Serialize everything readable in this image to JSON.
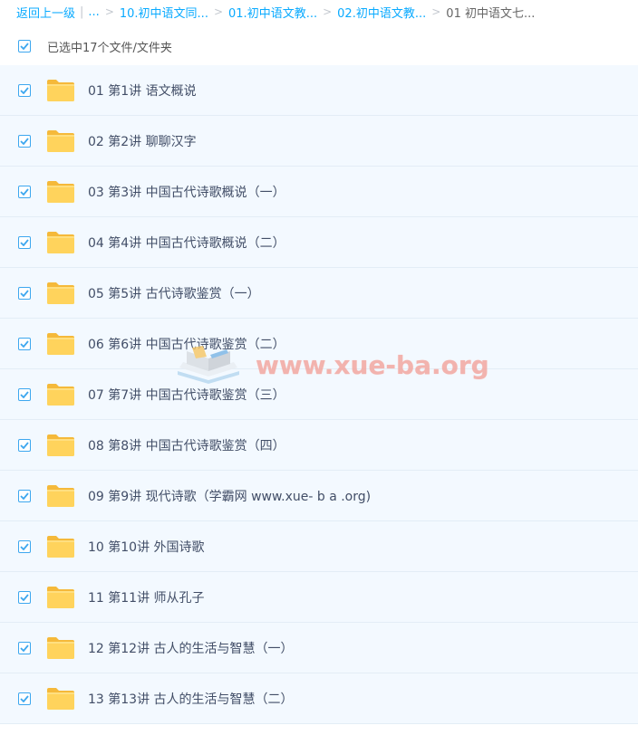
{
  "breadcrumb": {
    "back_label": "返回上一级",
    "pipe": "|",
    "ellipsis": "...",
    "sep": ">",
    "crumb1": "10.初中语文同...",
    "crumb2": "01.初中语文教...",
    "crumb3": "02.初中语文教...",
    "current": "01 初中语文七..."
  },
  "selection": {
    "label": "已选中17个文件/文件夹",
    "checked": true
  },
  "files": [
    {
      "name": "01 第1讲 语文概说",
      "type": "folder",
      "checked": true
    },
    {
      "name": "02 第2讲 聊聊汉字",
      "type": "folder",
      "checked": true
    },
    {
      "name": "03 第3讲 中国古代诗歌概说（一）",
      "type": "folder",
      "checked": true
    },
    {
      "name": "04 第4讲 中国古代诗歌概说（二）",
      "type": "folder",
      "checked": true
    },
    {
      "name": "05 第5讲 古代诗歌鉴赏（一）",
      "type": "folder",
      "checked": true
    },
    {
      "name": "06 第6讲 中国古代诗歌鉴赏（二）",
      "type": "folder",
      "checked": true
    },
    {
      "name": "07 第7讲 中国古代诗歌鉴赏（三）",
      "type": "folder",
      "checked": true
    },
    {
      "name": "08 第8讲 中国古代诗歌鉴赏（四）",
      "type": "folder",
      "checked": true
    },
    {
      "name": "09 第9讲 现代诗歌（学霸网 www.xue- b a .org)",
      "type": "folder",
      "checked": true
    },
    {
      "name": "10 第10讲 外国诗歌",
      "type": "folder",
      "checked": true
    },
    {
      "name": "11 第11讲 师从孔子",
      "type": "folder",
      "checked": true
    },
    {
      "name": "12 第12讲 古人的生活与智慧（一）",
      "type": "folder",
      "checked": true
    },
    {
      "name": "13 第13讲 古人的生活与智慧（二）",
      "type": "folder",
      "checked": true
    }
  ],
  "watermark": {
    "text": "www.xue-ba.org"
  },
  "colors": {
    "link": "#09aaff",
    "checkbox": "#3da7ef",
    "row_bg": "#f3f9ff",
    "folder": "#ffd35c",
    "watermark": "#f2a7a0"
  },
  "icons": {
    "checkbox": "checkmark-icon",
    "folder": "folder-icon",
    "watermark_logo": "book-logo-icon"
  }
}
